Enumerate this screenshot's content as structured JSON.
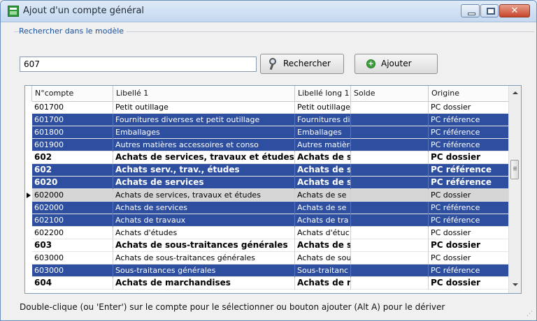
{
  "window": {
    "title": "Ajout d'un compte général",
    "close_glyph": "✕"
  },
  "search": {
    "group_label": "Rechercher dans le modèle",
    "value": "607",
    "search_button": "Rechercher",
    "add_button": "Ajouter",
    "add_icon_glyph": "+"
  },
  "grid": {
    "columns": [
      "N°compte",
      "Libellé 1",
      "Libellé long 1",
      "Solde",
      "Origine"
    ],
    "rows": [
      {
        "account": "601700",
        "label": "Petit outillage",
        "long_label": "Petit outillage",
        "balance": "",
        "origin": "PC dossier",
        "selected": false,
        "bold": false,
        "current": false
      },
      {
        "account": "601700",
        "label": "Fournitures diverses et petit outillage",
        "long_label": "Fournitures di",
        "balance": "",
        "origin": "PC référence",
        "selected": true,
        "bold": false,
        "current": false
      },
      {
        "account": "601800",
        "label": "Emballages",
        "long_label": "Emballages",
        "balance": "",
        "origin": "PC référence",
        "selected": true,
        "bold": false,
        "current": false
      },
      {
        "account": "601900",
        "label": "Autres matières accessoires et conso",
        "long_label": "Autres matière",
        "balance": "",
        "origin": "PC référence",
        "selected": true,
        "bold": false,
        "current": false
      },
      {
        "account": "602",
        "label": "Achats de services, travaux et études",
        "long_label": "Achats de s",
        "balance": "",
        "origin": "PC dossier",
        "selected": false,
        "bold": true,
        "current": false
      },
      {
        "account": "602",
        "label": "Achats serv., trav., études",
        "long_label": "Achats de s",
        "balance": "",
        "origin": "PC référence",
        "selected": true,
        "bold": true,
        "current": false
      },
      {
        "account": "6020",
        "label": "Achats de services",
        "long_label": "Achats de s",
        "balance": "",
        "origin": "PC référence",
        "selected": true,
        "bold": true,
        "current": false
      },
      {
        "account": "602000",
        "label": "Achats de services, travaux et études",
        "long_label": "Achats de se",
        "balance": "",
        "origin": "PC dossier",
        "selected": false,
        "bold": false,
        "current": true
      },
      {
        "account": "602000",
        "label": "Achats de services",
        "long_label": "Achats de se",
        "balance": "",
        "origin": "PC référence",
        "selected": true,
        "bold": false,
        "current": false
      },
      {
        "account": "602100",
        "label": "Achats de travaux",
        "long_label": "Achats de tra",
        "balance": "",
        "origin": "PC référence",
        "selected": true,
        "bold": false,
        "current": false
      },
      {
        "account": "602200",
        "label": "Achats d'études",
        "long_label": "Achats d'étuc",
        "balance": "",
        "origin": "PC dossier",
        "selected": false,
        "bold": false,
        "current": false
      },
      {
        "account": "603",
        "label": "Achats de sous-traitances générales",
        "long_label": "Achats de s",
        "balance": "",
        "origin": "PC dossier",
        "selected": false,
        "bold": true,
        "current": false
      },
      {
        "account": "603000",
        "label": "Achats de sous-traitances générales",
        "long_label": "Achats de sou",
        "balance": "",
        "origin": "PC dossier",
        "selected": false,
        "bold": false,
        "current": false
      },
      {
        "account": "603000",
        "label": "Sous-traitances générales",
        "long_label": "Sous-traitanc",
        "balance": "",
        "origin": "PC référence",
        "selected": true,
        "bold": false,
        "current": false
      },
      {
        "account": "604",
        "label": "Achats de marchandises",
        "long_label": "Achats de r",
        "balance": "",
        "origin": "PC dossier",
        "selected": false,
        "bold": true,
        "current": false
      }
    ]
  },
  "footer": {
    "hint": "Double-clique (ou 'Enter') sur le compte pour le sélectionner ou bouton ajouter (Alt A) pour le dériver"
  }
}
